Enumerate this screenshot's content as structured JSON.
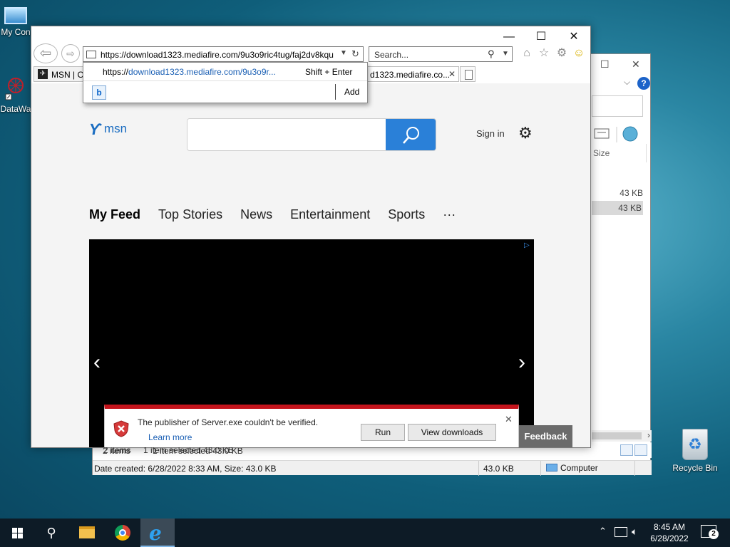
{
  "desktop": {
    "icons": [
      {
        "label": "My Con"
      },
      {
        "label": "DataWa"
      },
      {
        "label": "Recycle Bin"
      }
    ]
  },
  "explorer": {
    "size_header": "Size",
    "rows": [
      {
        "size": "43 KB"
      },
      {
        "size": "43 KB"
      }
    ],
    "items_count": "2 items",
    "selected_info": "1 item selected  43.0 KB",
    "status_details": "Date created: 6/28/2022 8:33 AM, Size: 43.0 KB",
    "status_size": "43.0 KB",
    "status_location": "Computer"
  },
  "ie": {
    "address_url": "https://download1323.mediafire.com/9u3o9ric4tug/faj2dv8kqu",
    "search_placeholder": "Search...",
    "tabs": [
      {
        "label": "MSN | O"
      },
      {
        "label": "d1323.mediafire.co..."
      }
    ],
    "suggestion": {
      "url_prefix": "https://",
      "url_rest": "download1323.mediafire.com/9u3o9r...",
      "shortcut": "Shift + Enter",
      "add_label": "Add"
    },
    "page": {
      "logo_text": "msn",
      "sign_in": "Sign in",
      "nav": [
        "My Feed",
        "Top Stories",
        "News",
        "Entertainment",
        "Sports",
        "···"
      ]
    },
    "download_bar": {
      "message": "The publisher of Server.exe couldn't be verified.",
      "learn_more": "Learn more",
      "run_label": "Run",
      "view_downloads_label": "View downloads"
    },
    "feedback_label": "Feedback"
  },
  "taskbar": {
    "time": "8:45 AM",
    "date": "6/28/2022",
    "notification_count": "2"
  },
  "colors": {
    "ie_accent": "#2a80d8",
    "warning_red": "#c4141c",
    "taskbar_bg": "#0d1b26"
  }
}
